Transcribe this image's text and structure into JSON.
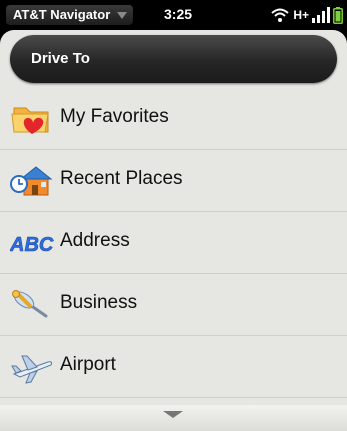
{
  "status_bar": {
    "app_name": "AT&T Navigator",
    "time": "3:25",
    "network": "H+"
  },
  "header": {
    "title": "Drive To"
  },
  "menu": {
    "items": [
      {
        "label": "My Favorites",
        "icon": "folder-heart-icon"
      },
      {
        "label": "Recent Places",
        "icon": "recent-places-icon"
      },
      {
        "label": "Address",
        "icon": "abc-icon"
      },
      {
        "label": "Business",
        "icon": "pushpin-icon"
      },
      {
        "label": "Airport",
        "icon": "airplane-icon"
      }
    ]
  },
  "footer": {
    "icon": "scroll-down-arrow-icon"
  }
}
